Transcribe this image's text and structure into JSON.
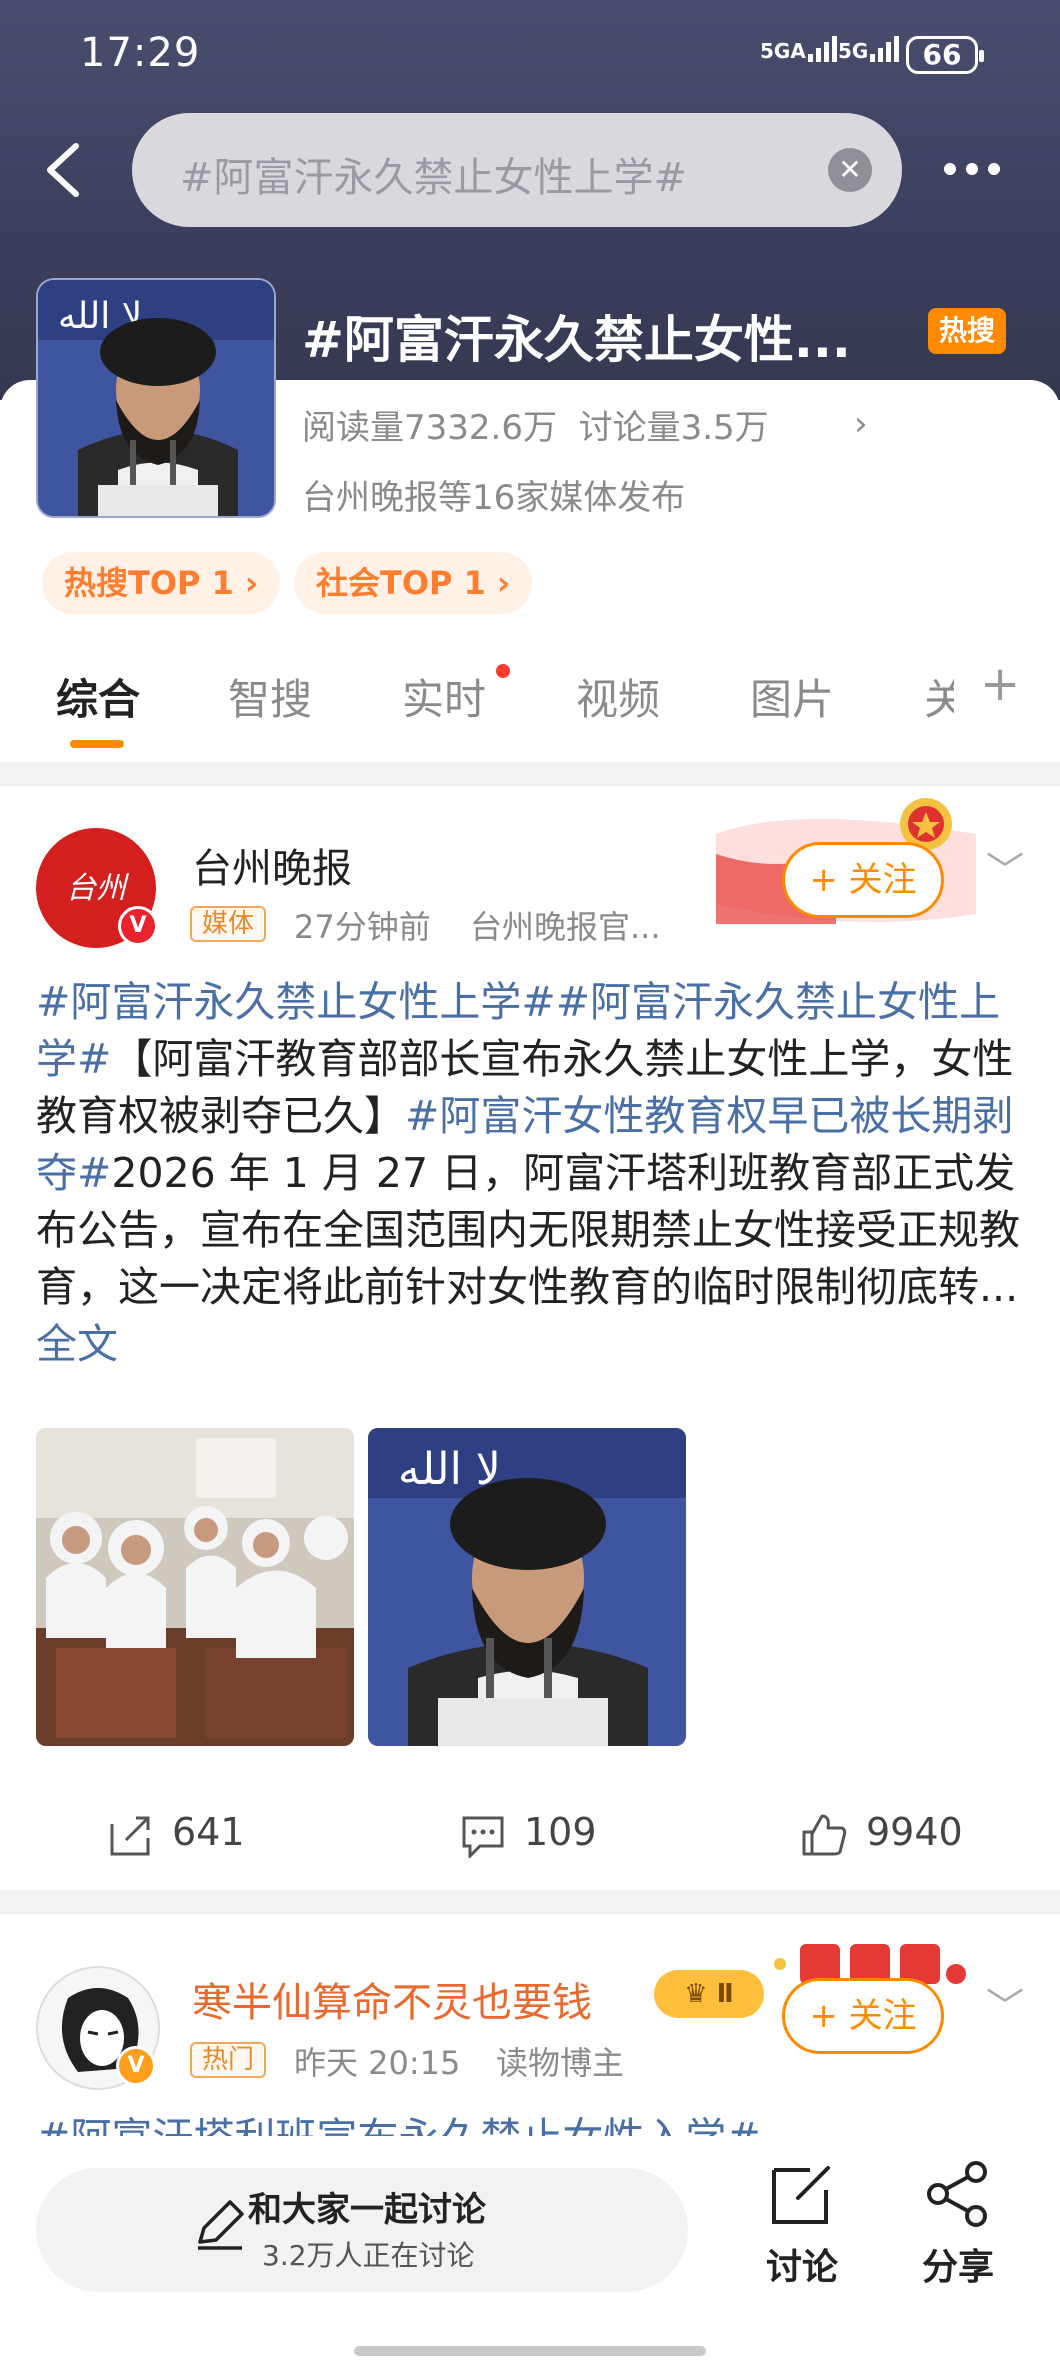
{
  "status_bar": {
    "time": "17:29",
    "signal1": "5GA",
    "signal2": "5G",
    "battery": "66"
  },
  "search": {
    "query": "#阿富汗永久禁止女性上学#"
  },
  "topic": {
    "title": "#阿富汗永久禁止女性...",
    "hot_badge": "热搜",
    "reads": "阅读量7332.6万",
    "discussions": "讨论量3.5万",
    "media": "台州晚报等16家媒体发布",
    "rank_hot": "热搜TOP 1 ›",
    "rank_social": "社会TOP 1 ›"
  },
  "tabs": [
    "综合",
    "智搜",
    "实时",
    "视频",
    "图片",
    "关"
  ],
  "post1": {
    "user": "台州晚报",
    "tag": "媒体",
    "time": "27分钟前",
    "source": "台州晚报官...",
    "follow": "+ 关注",
    "hash1": "#阿富汗永久禁止女性上学##阿富汗永久禁止女性上学#",
    "text1": "【阿富汗教育部部长宣布永久禁止女性上学，女性教育权被剥夺已久】",
    "hash2": "#阿富汗女性教育权早已被长期剥夺#",
    "text2": "2026 年 1 月 27 日，阿富汗塔利班教育部正式发布公告，宣布在全国范围内无限期禁止女性接受正规教育，这一决定将此前针对女性教育的临时限制彻底转...",
    "more": " 全文",
    "reposts": "641",
    "comments": "109",
    "likes": "9940"
  },
  "post2": {
    "user": "寒半仙算命不灵也要钱",
    "level": "Ⅱ",
    "tag": "热门",
    "time": "昨天 20:15",
    "role": "读物博主",
    "follow": "+ 关注",
    "hash": "#阿富汗塔利班宣布永久禁止女性入学#"
  },
  "footer": {
    "discuss_title": "和大家一起讨论",
    "discuss_count": "3.2万人正在讨论",
    "comment": "讨论",
    "share": "分享"
  }
}
